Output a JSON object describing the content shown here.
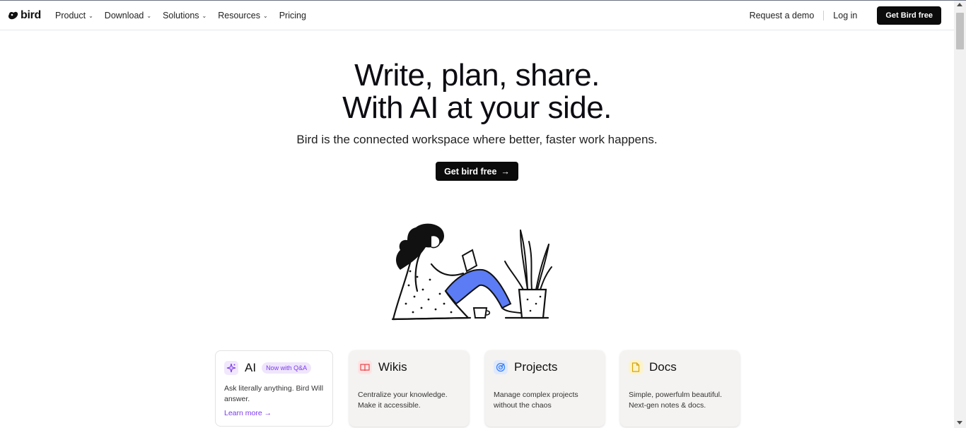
{
  "nav": {
    "logo": "bird",
    "links": [
      {
        "label": "Product",
        "has_menu": true
      },
      {
        "label": "Download",
        "has_menu": true
      },
      {
        "label": "Solutions",
        "has_menu": true
      },
      {
        "label": "Resources",
        "has_menu": true
      },
      {
        "label": "Pricing",
        "has_menu": false
      }
    ],
    "request_demo": "Request a demo",
    "login": "Log in",
    "cta": "Get Bird free"
  },
  "hero": {
    "title_line1": "Write, plan, share.",
    "title_line2": "With AI at your side.",
    "subtitle": "Bird is the connected workspace where better, faster work happens.",
    "cta": "Get bird free",
    "cta_arrow": "→"
  },
  "cards": {
    "ai": {
      "title": "AI",
      "badge": "Now with Q&A",
      "text": "Ask literally anything. Bird Will answer.",
      "link": "Learn more",
      "link_arrow": "→",
      "icon": "sparkle-icon"
    },
    "wikis": {
      "title": "Wikis",
      "text": "Centralize your knowledge. Make it accessible.",
      "icon": "book-icon"
    },
    "projects": {
      "title": "Projects",
      "text": "Manage complex projects without the chaos",
      "icon": "target-icon"
    },
    "docs": {
      "title": "Docs",
      "text": "Simple, powerfulm beautiful. Next-gen notes & docs.",
      "icon": "document-icon"
    }
  },
  "colors": {
    "accent_purple": "#7c3aed",
    "wikis_icon": "#e5484d",
    "projects_icon": "#3b82f6",
    "docs_icon": "#eab308",
    "illustration_pants": "#5b7cf5"
  }
}
